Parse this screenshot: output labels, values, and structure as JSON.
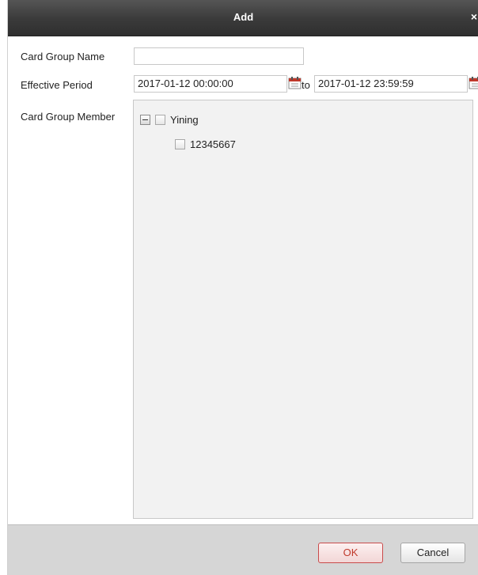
{
  "dialog": {
    "title": "Add",
    "close_glyph": "×"
  },
  "form": {
    "card_group_name_label": "Card Group Name",
    "card_group_name_value": "",
    "effective_period_label": "Effective Period",
    "start_datetime": "2017-01-12 00:00:00",
    "to_label": "to",
    "end_datetime": "2017-01-12 23:59:59",
    "card_group_member_label": "Card Group Member"
  },
  "tree": {
    "root": {
      "label": "Yining",
      "expanded": true,
      "checked": false
    },
    "children": [
      {
        "label": "12345667",
        "checked": false
      }
    ]
  },
  "buttons": {
    "ok_label": "OK",
    "cancel_label": "Cancel"
  },
  "icons": {
    "calendar": "calendar-icon",
    "collapse": "minus-toggle-icon",
    "close": "close-icon"
  },
  "colors": {
    "titlebar": "#3a3a3a",
    "ok_text": "#c0392b",
    "footer": "#d6d6d6"
  }
}
